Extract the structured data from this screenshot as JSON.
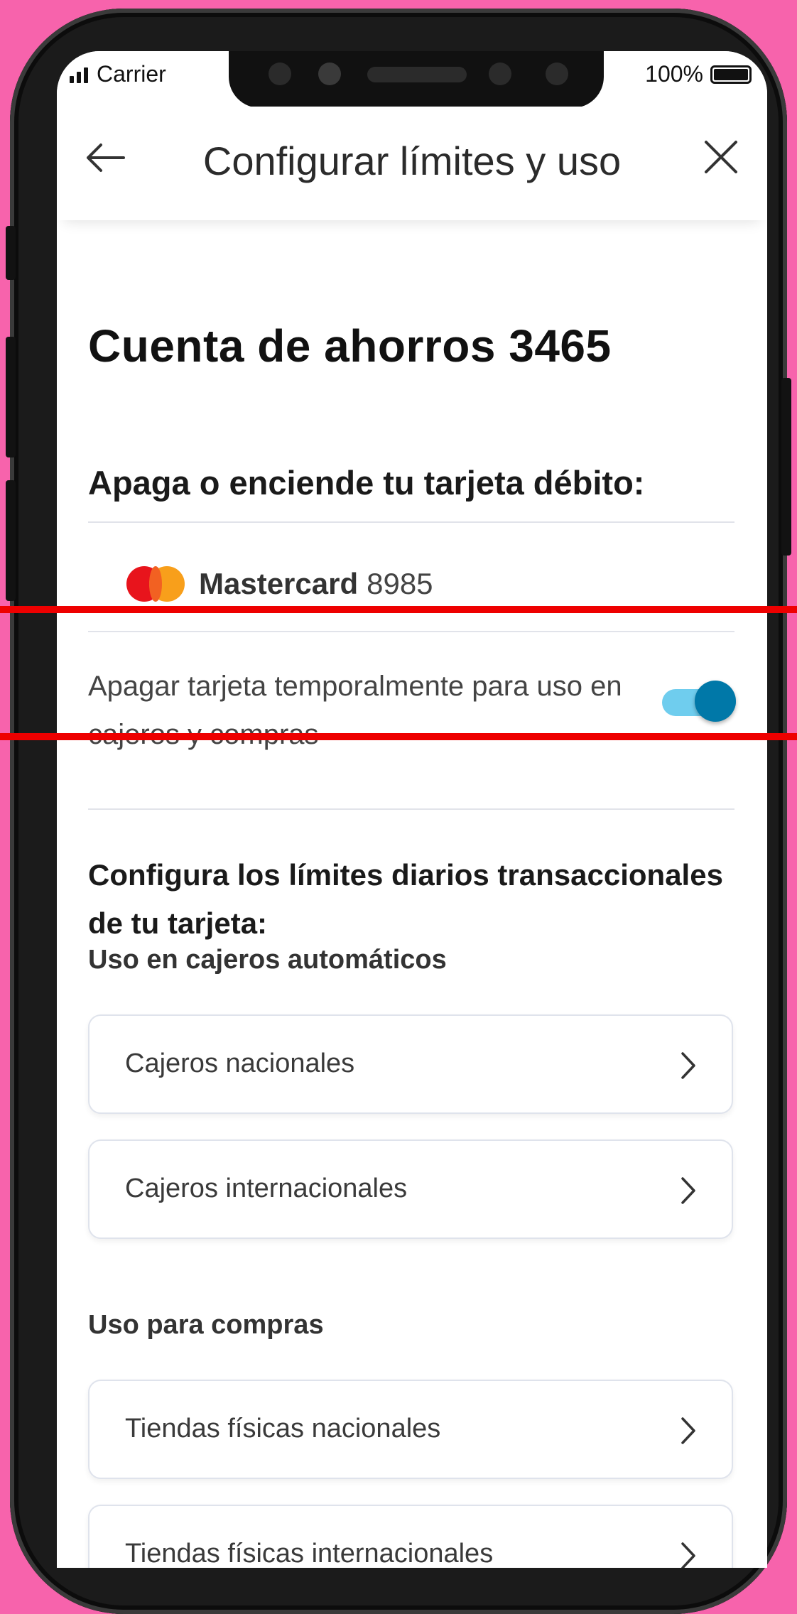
{
  "status_bar": {
    "carrier": "Carrier",
    "battery": "100%"
  },
  "header": {
    "title": "Configurar límites y uso"
  },
  "account": {
    "title": "Cuenta de ahorros 3465"
  },
  "debit": {
    "heading": "Apaga o enciende tu tarjeta débito:",
    "card_brand": "Mastercard",
    "card_number": "8985",
    "toggle_label": "Apagar tarjeta temporalmente para uso en cajeros y compras",
    "toggle_on": true
  },
  "limits": {
    "heading": "Configura los límites diarios transaccionales de tu tarjeta:",
    "atm_heading": "Uso en cajeros automáticos",
    "atm_items": [
      "Cajeros nacionales",
      "Cajeros internacionales"
    ],
    "purchase_heading": "Uso para compras",
    "purchase_items": [
      "Tiendas físicas nacionales",
      "Tiendas físicas internacionales"
    ]
  },
  "colors": {
    "background": "#f763ac",
    "toggle_track": "#6fcdee",
    "toggle_knob": "#0078a8",
    "highlight": "#ee0000",
    "mastercard_red": "#e8141c",
    "mastercard_orange": "#f89f1b"
  },
  "icons": [
    "back-arrow-icon",
    "close-icon",
    "chevron-right-icon",
    "mastercard-logo"
  ]
}
